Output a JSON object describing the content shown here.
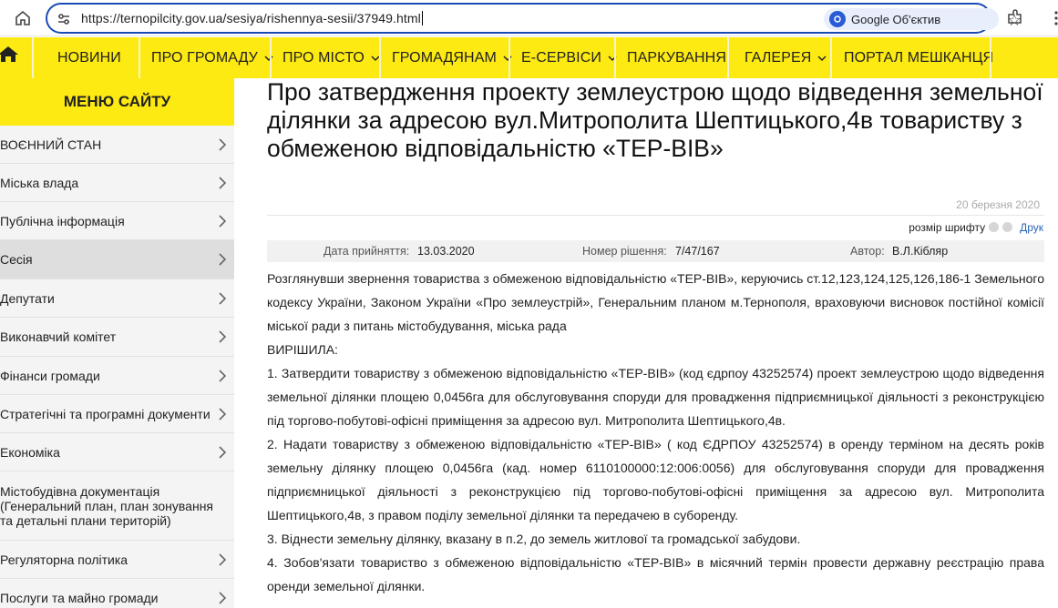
{
  "browser": {
    "url": "https://ternopilcity.gov.ua/sesiya/rishennya-sesii/37949.html",
    "lens_label": "Google Об'єктив"
  },
  "nav": {
    "items": [
      {
        "label": "НОВИНИ"
      },
      {
        "label": "ПРО ГРОМАДУ"
      },
      {
        "label": "ПРО МІСТО"
      },
      {
        "label": "ГРОМАДЯНАМ"
      },
      {
        "label": "Е-СЕРВІСИ"
      },
      {
        "label": "ПАРКУВАННЯ"
      },
      {
        "label": "ГАЛЕРЕЯ"
      },
      {
        "label": "ПОРТАЛ МЕШКАНЦЯ"
      }
    ]
  },
  "sidebar": {
    "title": "МЕНЮ САЙТУ",
    "items": [
      {
        "label": "ВОЄННИЙ СТАН"
      },
      {
        "label": "Міська влада"
      },
      {
        "label": "Публічна інформація"
      },
      {
        "label": "Сесія"
      },
      {
        "label": "Депутати"
      },
      {
        "label": "Виконавчий комітет"
      },
      {
        "label": "Фінанси громади"
      },
      {
        "label": "Стратегічні та програмні документи"
      },
      {
        "label": "Економіка"
      },
      {
        "label": "Містобудівна документація (Генеральний план, план зонування та детальні плани територій)"
      },
      {
        "label": "Регуляторна політика"
      },
      {
        "label": "Послуги та майно громади"
      }
    ]
  },
  "article": {
    "title": "Про затвердження проекту землеустрою щодо відведення земельної ділянки за адресою вул.Митрополита Шептицького,4в товариству з обмеженою відповідальністю «ТЕР-ВІВ»",
    "date": "20 березня 2020",
    "font_size_label": "розмір шрифту",
    "print_label": "Друк",
    "adopted_label": "Дата прийняття:",
    "adopted_value": "13.03.2020",
    "number_label": "Номер рішення:",
    "number_value": "7/47/167",
    "author_label": "Автор:",
    "author_value": "В.Л.Кібляр",
    "paragraphs": [
      "Розглянувши звернення товариства з обмеженою відповідальністю «ТЕР-ВІВ», керуючись ст.12,123,124,125,126,186-1 Земельного кодексу України, Законом України «Про землеустрій», Генеральним планом м.Тернополя, враховуючи висновок постійної комісії міської ради з питань містобудування, міська рада",
      "ВИРІШИЛА:",
      "1. Затвердити товариству з обмеженою відповідальністю «ТЕР-ВІВ» (код єдрпоу 43252574) проект землеустрою щодо відведення земельної ділянки площею 0,0456га для обслуговування споруди для провадження підприємницької діяльності з реконструкцією під торгово-побутові-офісні приміщення за адресою вул. Митрополита Шептицького,4в.",
      "2. Надати товариству з обмеженою відповідальністю «ТЕР-ВІВ» ( код ЄДРПОУ 43252574) в оренду терміном на десять років земельну ділянку площею 0,0456га (кад. номер 6110100000:12:006:0056) для обслуговування споруди для провадження підприємницької діяльності з реконструкцією під торгово-побутові-офісні приміщення за адресою вул. Митрополита Шептицького,4в, з правом поділу земельної ділянки та передачею в суборенду.",
      "3. Віднести земельну ділянку, вказану в п.2, до земель житлової та громадської забудови.",
      "4. Зобов'язати товариство з обмеженою відповідальністю «ТЕР-ВІВ» в місячний термін провести державну реєстрацію права оренди земельної ділянки."
    ]
  },
  "colors": {
    "brand_yellow": "#fdea12",
    "link_blue": "#2a66b6",
    "omnibox_border": "#1a4bb5"
  }
}
